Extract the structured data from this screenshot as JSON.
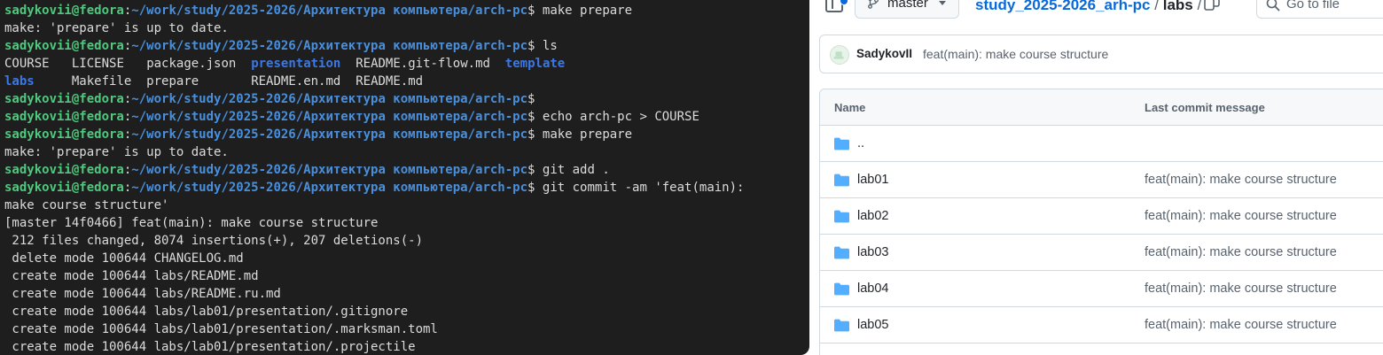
{
  "terminal": {
    "prompt": {
      "user_host": "sadykovii@fedora",
      "path": "~/work/study/2025-2026/Архитектура компьютера/arch-pc"
    },
    "lines": [
      {
        "type": "cmd",
        "text": " make prepare"
      },
      {
        "type": "out",
        "text": "make: 'prepare' is up to date."
      },
      {
        "type": "cmd",
        "text": " ls"
      },
      {
        "type": "ls",
        "cols": [
          {
            "text": "COURSE",
            "dir": false
          },
          {
            "text": "LICENSE",
            "dir": false
          },
          {
            "text": "package.json",
            "dir": false
          },
          {
            "text": "presentation",
            "dir": true
          },
          {
            "text": "README.git-flow.md",
            "dir": false
          },
          {
            "text": "template",
            "dir": true
          }
        ]
      },
      {
        "type": "ls",
        "cols": [
          {
            "text": "labs",
            "dir": true
          },
          {
            "text": "Makefile",
            "dir": false
          },
          {
            "text": "prepare",
            "dir": false
          },
          {
            "text": "README.en.md",
            "dir": false
          },
          {
            "text": "README.md",
            "dir": false
          },
          {
            "text": "",
            "dir": false
          }
        ]
      },
      {
        "type": "cmd",
        "text": ""
      },
      {
        "type": "cmd",
        "text": " echo arch-pc > COURSE"
      },
      {
        "type": "cmd",
        "text": " make prepare"
      },
      {
        "type": "out",
        "text": "make: 'prepare' is up to date."
      },
      {
        "type": "cmd",
        "text": " git add ."
      },
      {
        "type": "cmd",
        "text": " git commit -am 'feat(main):"
      },
      {
        "type": "out",
        "text": "make course structure'"
      },
      {
        "type": "out",
        "text": "[master 14f0466] feat(main): make course structure"
      },
      {
        "type": "out",
        "text": " 212 files changed, 8074 insertions(+), 207 deletions(-)"
      },
      {
        "type": "out",
        "text": " delete mode 100644 CHANGELOG.md"
      },
      {
        "type": "out",
        "text": " create mode 100644 labs/README.md"
      },
      {
        "type": "out",
        "text": " create mode 100644 labs/README.ru.md"
      },
      {
        "type": "out",
        "text": " create mode 100644 labs/lab01/presentation/.gitignore"
      },
      {
        "type": "out",
        "text": " create mode 100644 labs/lab01/presentation/.marksman.toml"
      },
      {
        "type": "out",
        "text": " create mode 100644 labs/lab01/presentation/.projectile"
      }
    ]
  },
  "github": {
    "branch": "master",
    "breadcrumb": {
      "repo": "study_2025-2026_arh-pc",
      "separator": "/",
      "current": "labs",
      "trailing": "/"
    },
    "goto_file_placeholder": "Go to file",
    "commit": {
      "author": "SadykovII",
      "message": "feat(main): make course structure"
    },
    "table": {
      "headers": {
        "name": "Name",
        "last_commit": "Last commit message"
      },
      "rows": [
        {
          "name": "..",
          "commit": ""
        },
        {
          "name": "lab01",
          "commit": "feat(main): make course structure"
        },
        {
          "name": "lab02",
          "commit": "feat(main): make course structure"
        },
        {
          "name": "lab03",
          "commit": "feat(main): make course structure"
        },
        {
          "name": "lab04",
          "commit": "feat(main): make course structure"
        },
        {
          "name": "lab05",
          "commit": "feat(main): make course structure"
        }
      ]
    }
  },
  "colors": {
    "terminal_bg": "#1e1e1e",
    "prompt_user": "#4ec97e",
    "prompt_path": "#4a8fdb",
    "directory": "#3b78e7",
    "link": "#0969da",
    "folder_icon": "#54aeff"
  },
  "icons": [
    "sidebar-toggle-icon",
    "git-branch-icon",
    "caret-down-icon",
    "copy-icon",
    "search-icon",
    "folder-icon",
    "avatar"
  ]
}
